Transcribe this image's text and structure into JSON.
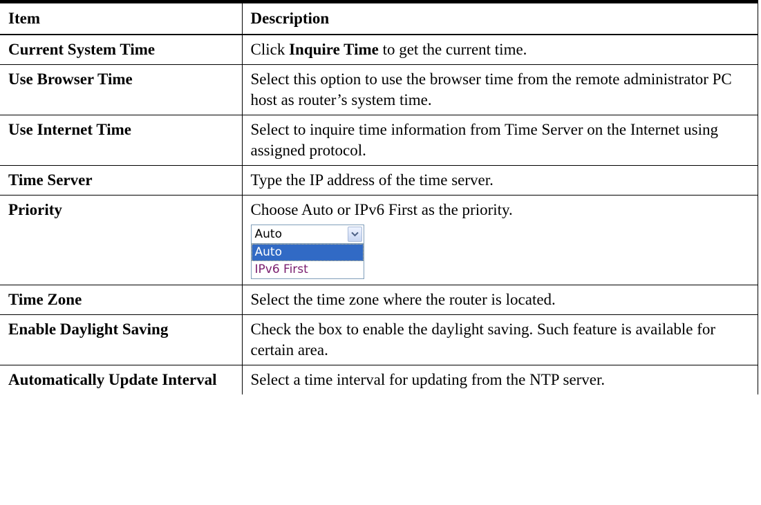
{
  "table": {
    "header": {
      "item": "Item",
      "description": "Description"
    },
    "rows": [
      {
        "item": "Current System Time",
        "desc_before": "Click ",
        "desc_bold": "Inquire Time",
        "desc_after": " to get the current time."
      },
      {
        "item": "Use Browser Time",
        "description": "Select this option to use the browser time from the remote administrator PC host as router’s system time."
      },
      {
        "item": "Use Internet Time",
        "description": "Select to inquire time information from Time Server on the Internet using assigned protocol."
      },
      {
        "item": "Time Server",
        "description": "Type the IP address of the time server."
      },
      {
        "item": "Priority",
        "description": "Choose Auto or IPv6 First as the priority.",
        "dropdown": {
          "selected": "Auto",
          "options": [
            "Auto",
            "IPv6 First"
          ],
          "highlighted_option": "Auto"
        }
      },
      {
        "item": "Time Zone",
        "description": "Select the time zone where the router is located."
      },
      {
        "item": "Enable Daylight Saving",
        "description": "Check the box to enable the daylight saving. Such feature is available for certain area."
      },
      {
        "item": "Automatically Update Interval",
        "description": "Select a time interval for updating from the NTP server."
      }
    ]
  },
  "colors": {
    "dropdown_highlight": "#316ac5",
    "dropdown_border": "#7f9db9",
    "option_text": "#7a1d6e"
  },
  "icons": {
    "dropdown_arrow": "chevron-down-icon"
  }
}
